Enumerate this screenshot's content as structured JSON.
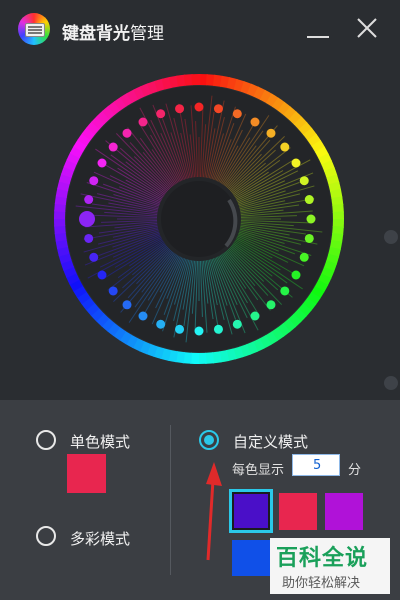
{
  "app": {
    "title_bold": "键盘背光",
    "title_rest": "管理",
    "icon": "keyboard-icon"
  },
  "window_controls": {
    "minimize_icon": "minimize-icon",
    "close_icon": "close-icon"
  },
  "modes": {
    "single_color": {
      "label": "单色模式",
      "selected": false,
      "color": "#e8264f"
    },
    "multi_color": {
      "label": "多彩模式",
      "selected": false
    },
    "custom": {
      "label": "自定义模式",
      "selected": true,
      "interval_prefix": "每色显示",
      "interval_value": "5",
      "interval_unit": "分"
    }
  },
  "custom_colors": [
    {
      "color": "#4a0fc8",
      "selected": true
    },
    {
      "color": "#e8264f",
      "selected": false
    },
    {
      "color": "#b012d8",
      "selected": false
    },
    {
      "color": "#1050e8",
      "selected": false
    }
  ],
  "watermark": {
    "title": "百科全说",
    "subtitle": "助你轻松解决"
  },
  "colors": {
    "accent": "#2bc8e8",
    "background": "#2a2d31",
    "panel": "#3b3e43",
    "arrow": "#e02a2a"
  }
}
